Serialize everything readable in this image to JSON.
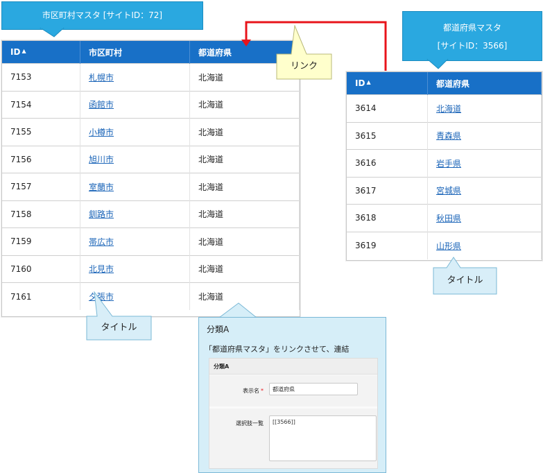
{
  "left_callout": {
    "title": "市区町村マスタ [サイトID：72]"
  },
  "right_callout": {
    "line1": "都道府県マスタ",
    "line2": "[サイトID：3566]"
  },
  "link_label": "リンク",
  "title_label_left": "タイトル",
  "title_label_right": "タイトル",
  "left_table": {
    "headers": [
      "ID",
      "市区町村",
      "都道府県"
    ],
    "rows": [
      [
        "7153",
        "札幌市",
        "北海道"
      ],
      [
        "7154",
        "函館市",
        "北海道"
      ],
      [
        "7155",
        "小樽市",
        "北海道"
      ],
      [
        "7156",
        "旭川市",
        "北海道"
      ],
      [
        "7157",
        "室蘭市",
        "北海道"
      ],
      [
        "7158",
        "釧路市",
        "北海道"
      ],
      [
        "7159",
        "帯広市",
        "北海道"
      ],
      [
        "7160",
        "北見市",
        "北海道"
      ],
      [
        "7161",
        "夕張市",
        "北海道"
      ]
    ]
  },
  "right_table": {
    "headers": [
      "ID",
      "都道府県"
    ],
    "rows": [
      [
        "3614",
        "北海道"
      ],
      [
        "3615",
        "青森県"
      ],
      [
        "3616",
        "岩手県"
      ],
      [
        "3617",
        "宮城県"
      ],
      [
        "3618",
        "秋田県"
      ],
      [
        "3619",
        "山形県"
      ]
    ]
  },
  "settings_panel": {
    "heading": "分類A",
    "description": "「都道府県マスタ」をリンクさせて、連結",
    "section_title": "分類A",
    "display_name_label": "表示名",
    "required_mark": "*",
    "display_name_value": "都道府県",
    "choices_label": "選択肢一覧",
    "choices_value": "[[3566]]"
  },
  "colors": {
    "header_blue": "#1870c7",
    "callout_blue": "#2aa8e0",
    "link_arrow_red": "#e8141b",
    "link_text": "#1a64b8"
  }
}
